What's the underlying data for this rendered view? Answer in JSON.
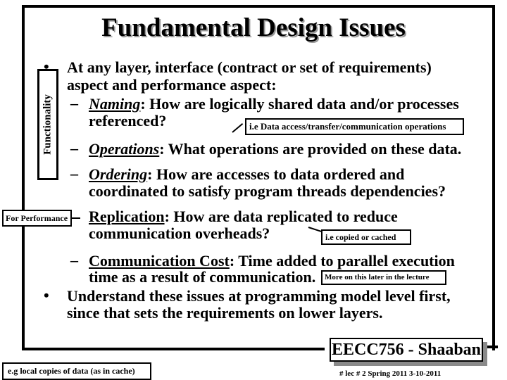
{
  "slide": {
    "title": "Fundamental Design Issues",
    "side_labels": {
      "functionality": "Functionality",
      "for_performance": "For Performance"
    },
    "bullet1": {
      "line1": "At any layer, interface (contract or set of requirements)",
      "line2": "aspect and performance aspect:"
    },
    "naming": {
      "term": "Naming",
      "rest_line1": ":  How are logically shared data and/or processes",
      "line2": "referenced?",
      "callout": "i.e Data access/transfer/communication operations"
    },
    "operations": {
      "term": "Operations",
      "rest": ":  What operations are provided on these data."
    },
    "ordering": {
      "term": "Ordering",
      "rest_line1": ":   How are accesses to data ordered and",
      "line2": "coordinated to satisfy program threads dependencies?"
    },
    "replication": {
      "term": "Replication",
      "rest_line1": ":   How are data replicated to reduce",
      "line2": "communication overheads?",
      "callout": "i.e copied or cached"
    },
    "communication_cost": {
      "term": "Communication Cost",
      "rest_line1": ": Time added to parallel execution",
      "line2": "time as a result of communication.",
      "callout": "More on this later in the lecture"
    },
    "bullet2": {
      "line1": "Understand these issues at programming model level first,",
      "line2": "since that sets the requirements on lower layers."
    },
    "bottom_note": "e.g  local copies of data (as in cache)",
    "footer": {
      "course": "EECC756 - Shaaban",
      "meta": "#  lec # 2    Spring 2011   3-10-2011"
    },
    "symbols": {
      "bullet": "•",
      "dash": "–"
    }
  }
}
